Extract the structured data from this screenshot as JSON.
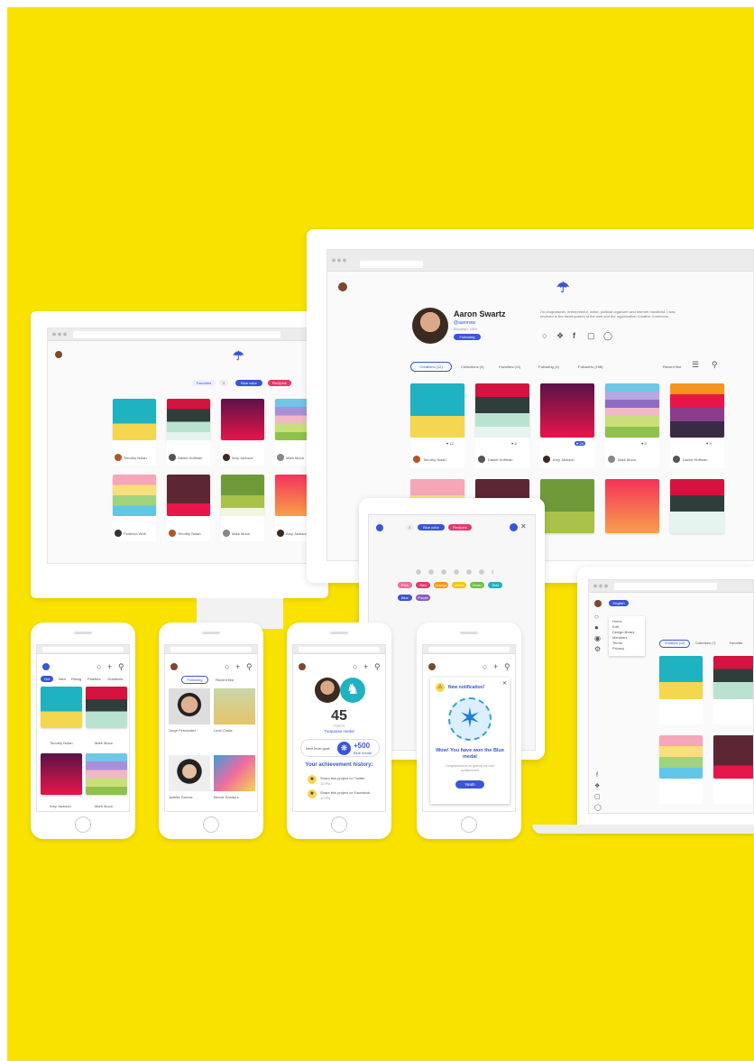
{
  "colors": {
    "background": "#f9e200",
    "accent": "#3a55d6",
    "pink": "#e8366b"
  },
  "desktop_main": {
    "profile": {
      "name": "Aaron Swartz",
      "handle": "@aaronsw",
      "location": "Brooklyn, USA",
      "follow_button": "Following",
      "bio": "I'm programmer, entrepreneur, writer, political organizer and Internet hacktivist. I was involved in the development of the web and the organization Creative Commons."
    },
    "social_icons": [
      "globe-icon",
      "twitter-icon",
      "facebook-icon",
      "instagram-icon",
      "github-icon"
    ],
    "tabs": [
      {
        "label": "Creations (12)",
        "active": true
      },
      {
        "label": "Collections (4)",
        "active": false
      },
      {
        "label": "Favorites (11)",
        "active": false
      },
      {
        "label": "Following (4)",
        "active": false
      },
      {
        "label": "Followers (198)",
        "active": false
      }
    ],
    "sort_label": "Recent first",
    "cards": [
      {
        "author": "Timothy Nolan",
        "likes": "♥ 12"
      },
      {
        "author": "Daniel Hoffman",
        "likes": "♥ 8"
      },
      {
        "author": "Amy Jackson",
        "likes": "♥ 24"
      },
      {
        "author": "Mark Moon",
        "likes": "♥ 5"
      },
      {
        "author": "Daniel Hoffman",
        "likes": "♥ 9"
      }
    ]
  },
  "desktop_left": {
    "filters": [
      "Favorites",
      "Blue color",
      "Red/pink"
    ],
    "cards": [
      {
        "author": "Timothy Nolan"
      },
      {
        "author": "Daniel Hoffman"
      },
      {
        "author": "Amy Jackson"
      },
      {
        "author": "Mark Moon"
      },
      {
        "author": "Federico Wolf"
      },
      {
        "author": "Timothy Nolan"
      },
      {
        "author": "Mark Moon"
      },
      {
        "author": "Amy Jackson"
      }
    ]
  },
  "tablet": {
    "filter_tags": [
      "Blue color",
      "Red/pink"
    ],
    "palette_tags": [
      "Pink",
      "Red",
      "Orange",
      "Yellow",
      "Green",
      "Teal",
      "Blue",
      "Purple"
    ]
  },
  "laptop": {
    "user_pill": "English",
    "tabs": [
      "Creations (12)",
      "Collections (7)",
      "Favorites"
    ],
    "menu_items": [
      "Home",
      "Edit",
      "Design library",
      "Members",
      "Terms",
      "Privacy"
    ]
  },
  "phone1": {
    "tabs": [
      "Hot",
      "New",
      "Rising",
      "Palettes",
      "Gradients"
    ],
    "authors": [
      "Timothy Nolan",
      "Mark Moon",
      "Amy Jackson",
      "Mark Moon"
    ]
  },
  "phone2": {
    "filter": "Following",
    "sort": "Recent first",
    "people": [
      "Jorge Fernandez",
      "Leon Costa",
      "Juliette Gomez",
      "Bernie Sanders"
    ]
  },
  "phone3": {
    "score": "45",
    "score_unit": "POINTS",
    "medal": "Turquoise medal",
    "next_level": "Next level goal:",
    "next_points": "+500",
    "next_medal": "Blue medal",
    "history_title": "Your achievement history:",
    "history": [
      {
        "text": "Share this project on Twitter",
        "points": "10 Pts"
      },
      {
        "text": "Share this project on Facebook",
        "points": "10 Pts"
      }
    ]
  },
  "phone4": {
    "notification_title": "New notification!",
    "message": "Wow! You have won the Blue medal",
    "sub": "Congratulations on getting the next achievement",
    "button": "Yeah!"
  }
}
